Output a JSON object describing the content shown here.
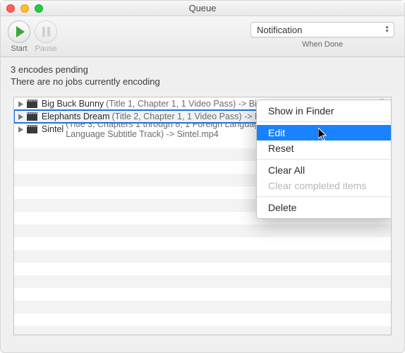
{
  "window": {
    "title": "Queue"
  },
  "toolbar": {
    "start_label": "Start",
    "pause_label": "Pause",
    "when_done_select_value": "Notification",
    "when_done_label": "When Done"
  },
  "status": {
    "pending": "3 encodes pending",
    "current": "There are no jobs currently encoding"
  },
  "jobs": [
    {
      "name": "Big Buck Bunny",
      "details": "(Title 1, Chapter 1, 1 Video Pass) -> Big Buck Bunny.mp4"
    },
    {
      "name": "Elephants Dream",
      "details": "(Title 2, Chapter 1, 1 Video Pass) -> Elephants Dream.mp4"
    },
    {
      "name": "Sintel",
      "details": "(Title 3, Chapters 1 through 8, 1 Foreign Language Audio Track, Foreign Language Subtitle Track) -> Sintel.mp4"
    }
  ],
  "selected_index": 1,
  "context_menu": {
    "show_in_finder": "Show in Finder",
    "edit": "Edit",
    "reset": "Reset",
    "clear_all": "Clear All",
    "clear_completed": "Clear completed items",
    "delete": "Delete",
    "highlighted": "edit"
  },
  "icons": {
    "close_x": "×"
  }
}
